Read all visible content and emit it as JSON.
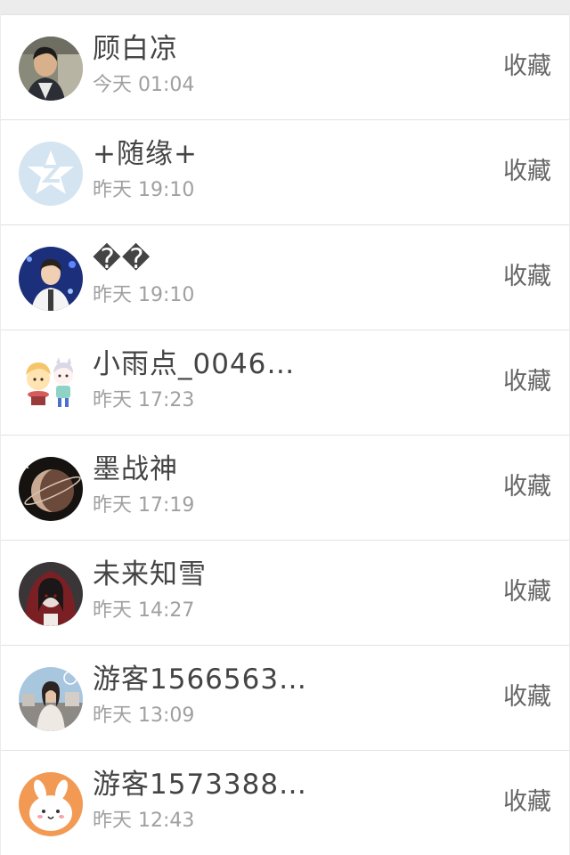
{
  "items": [
    {
      "name": "顾白凉",
      "time": "今天 01:04",
      "action": "收藏",
      "avatar_icon": "avatar-boy-photo-icon"
    },
    {
      "name": "+随缘+",
      "time": "昨天 19:10",
      "action": "收藏",
      "avatar_icon": "qzone-default-avatar-icon"
    },
    {
      "name": "��",
      "time": "昨天 19:10",
      "action": "收藏",
      "avatar_icon": "avatar-boy-stage-icon"
    },
    {
      "name": "小雨点_0046…",
      "time": "昨天 17:23",
      "action": "收藏",
      "avatar_icon": "avatar-cartoon-couple-icon"
    },
    {
      "name": "墨战神",
      "time": "昨天 17:19",
      "action": "收藏",
      "avatar_icon": "avatar-planet-icon"
    },
    {
      "name": "未来知雪",
      "time": "昨天 14:27",
      "action": "收藏",
      "avatar_icon": "avatar-red-hood-icon"
    },
    {
      "name": "游客1566563…",
      "time": "昨天 13:09",
      "action": "收藏",
      "avatar_icon": "avatar-city-street-icon"
    },
    {
      "name": "游客1573388…",
      "time": "昨天 12:43",
      "action": "收藏",
      "avatar_icon": "avatar-cartoon-rabbit-icon"
    }
  ]
}
